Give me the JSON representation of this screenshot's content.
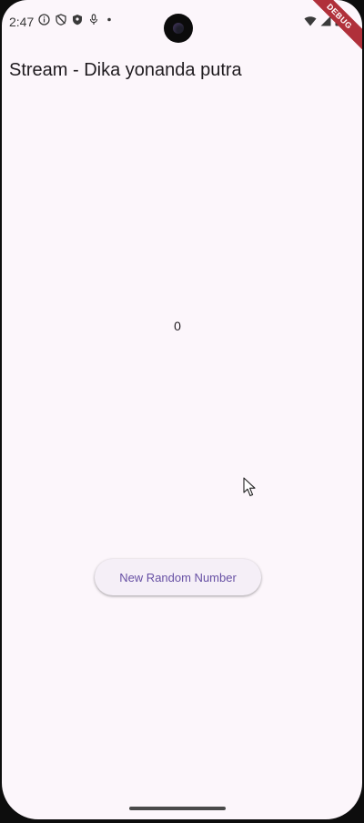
{
  "status_bar": {
    "time": "2:47",
    "left_icons": [
      "info-icon",
      "shield-slash-icon",
      "shield-icon",
      "mic-icon",
      "dot-icon"
    ],
    "right_icons": [
      "wifi-icon",
      "signal-icon",
      "battery-icon"
    ]
  },
  "debug_banner": {
    "label": "DEBUG",
    "color": "#b0303a"
  },
  "app_bar": {
    "title": "Stream - Dika yonanda putra"
  },
  "main": {
    "number_value": "0",
    "button_label": "New Random Number"
  },
  "colors": {
    "background": "#fcf6fb",
    "button_text": "#6750a4",
    "button_bg": "#f5eff7"
  }
}
